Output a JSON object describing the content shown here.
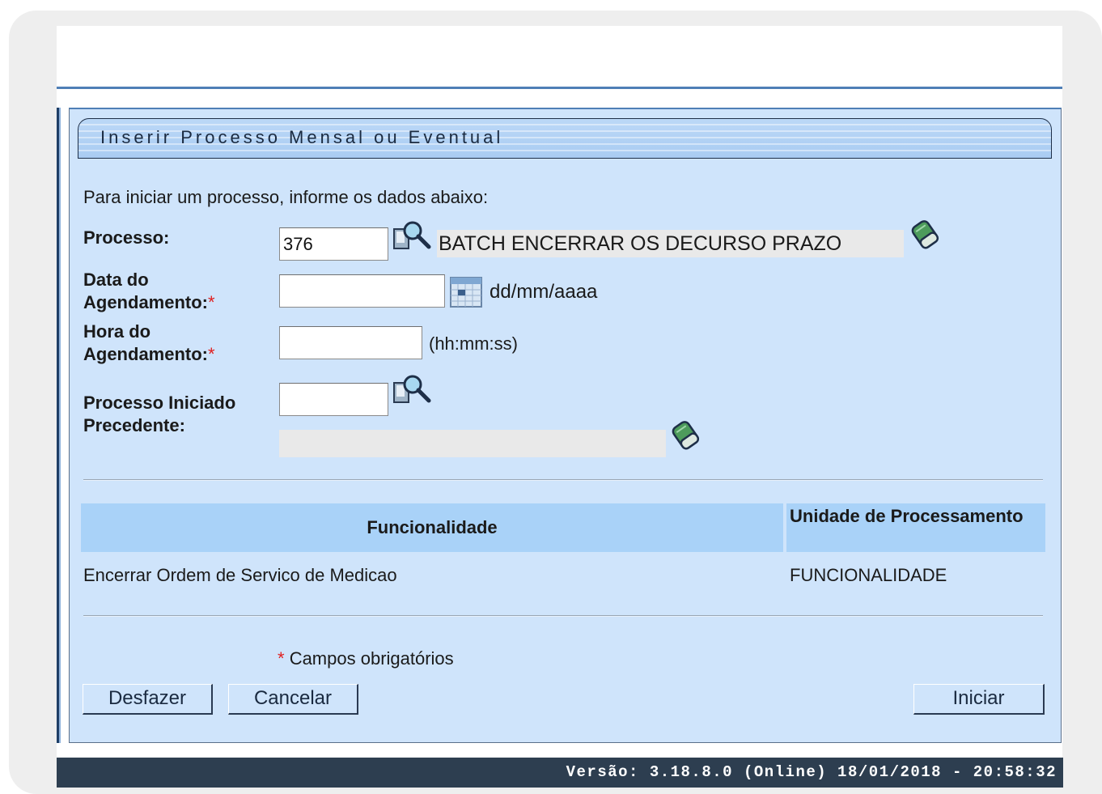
{
  "title": "Inserir Processo Mensal ou Eventual",
  "intro": "Para iniciar um processo, informe os dados abaixo:",
  "fields": {
    "processo": {
      "label": "Processo:",
      "value": "376",
      "description": "BATCH ENCERRAR OS DECURSO PRAZO"
    },
    "data_agendamento": {
      "label_line1": "Data do",
      "label_line2": "Agendamento:",
      "required_mark": "*",
      "value": "",
      "hint": "dd/mm/aaaa"
    },
    "hora_agendamento": {
      "label_line1": "Hora do",
      "label_line2": "Agendamento:",
      "required_mark": "*",
      "value": "",
      "hint": "(hh:mm:ss)"
    },
    "processo_precedente": {
      "label_line1": "Processo Iniciado",
      "label_line2": "Precedente:",
      "value": "",
      "description": ""
    }
  },
  "table": {
    "headers": [
      "Funcionalidade",
      "Unidade de Processamento"
    ],
    "rows": [
      [
        "Encerrar Ordem de Servico de Medicao",
        "FUNCIONALIDADE"
      ]
    ]
  },
  "required_note": {
    "mark": "*",
    "text": "Campos obrigatórios"
  },
  "buttons": {
    "undo": "Desfazer",
    "cancel": "Cancelar",
    "start": "Iniciar"
  },
  "footer": "Versão: 3.18.8.0 (Online) 18/01/2018 - 20:58:32",
  "icons": {
    "search": "magnifier-icon",
    "calendar": "calendar-icon",
    "clear": "eraser-icon"
  },
  "colors": {
    "panel_bg": "#cfe4fb",
    "header_bg": "#a9d2f8",
    "footer_bg": "#2d3e50",
    "required": "#e02020"
  }
}
